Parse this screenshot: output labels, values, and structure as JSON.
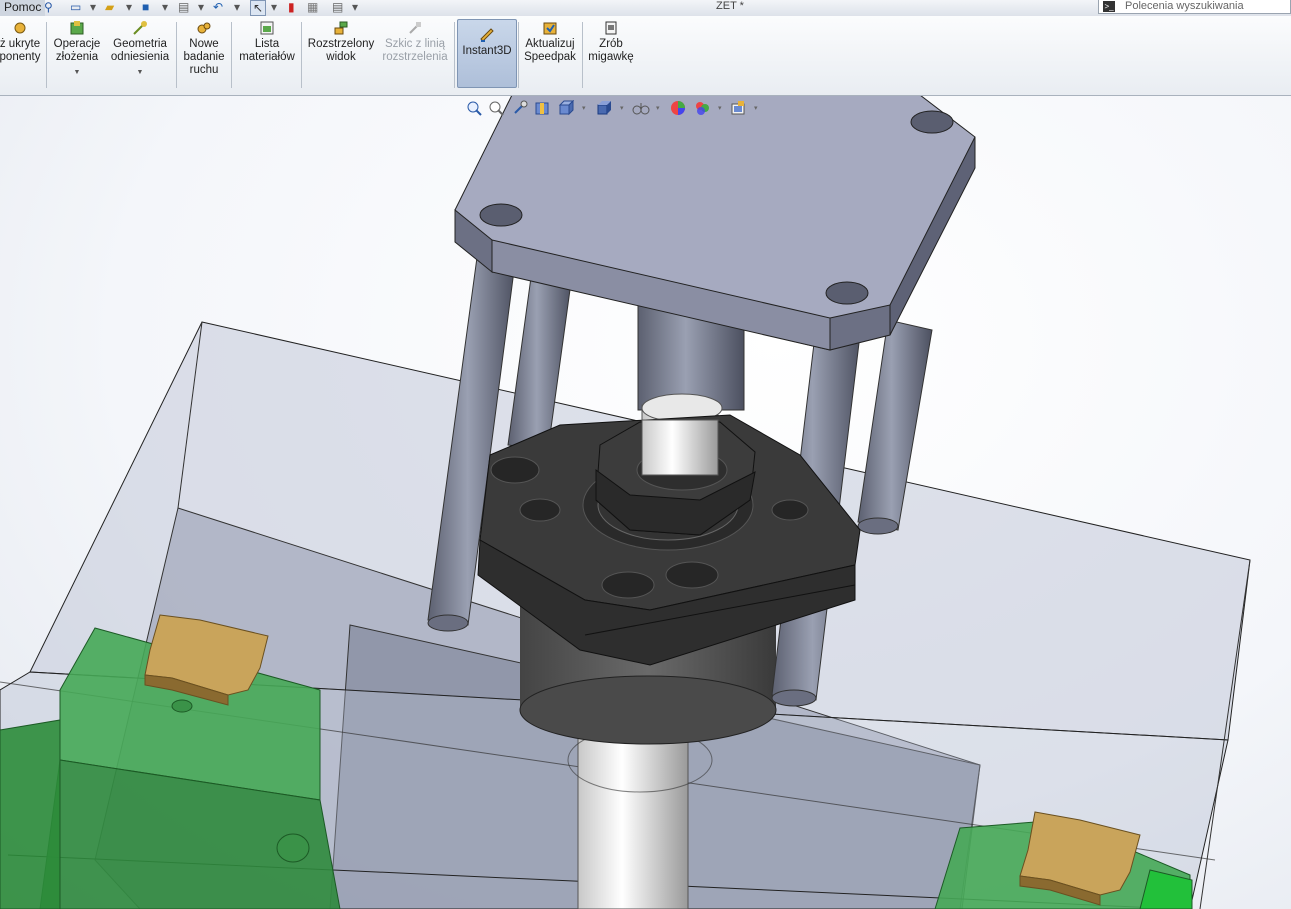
{
  "menu": {
    "help": "Pomoc"
  },
  "title": "ZET *",
  "search": {
    "placeholder": "Polecenia wyszukiwania"
  },
  "ribbon": {
    "hidden_components": "ż ukryte\nponenty",
    "assembly_features": "Operacje\nzłożenia",
    "reference_geometry": "Geometria\nodniesienia",
    "new_motion_study": "Nowe\nbadanie\nruchu",
    "bill_of_materials": "Lista\nmateriałów",
    "exploded_view": "Rozstrzelony\nwidok",
    "explode_line_sketch": "Szkic z linią\nrozstrzelenia",
    "instant3d": "Instant3D",
    "update_speedpak": "Aktualizuj\nSpeedpak",
    "take_snapshot": "Zrób\nmigawkę"
  },
  "colors": {
    "plate": "#9fa3b8",
    "dark_part": "#3d3d3d",
    "green_block": "#3fa34d",
    "tan_part": "#c9a45b",
    "glass": "#b9c0d4"
  },
  "icons": [
    "zoom-to-fit-icon",
    "zoom-area-icon",
    "previous-view-icon",
    "section-view-icon",
    "view-orientation-icon",
    "display-style-icon",
    "hide-show-icon",
    "appearance-icon",
    "scene-icon",
    "view-settings-icon"
  ]
}
